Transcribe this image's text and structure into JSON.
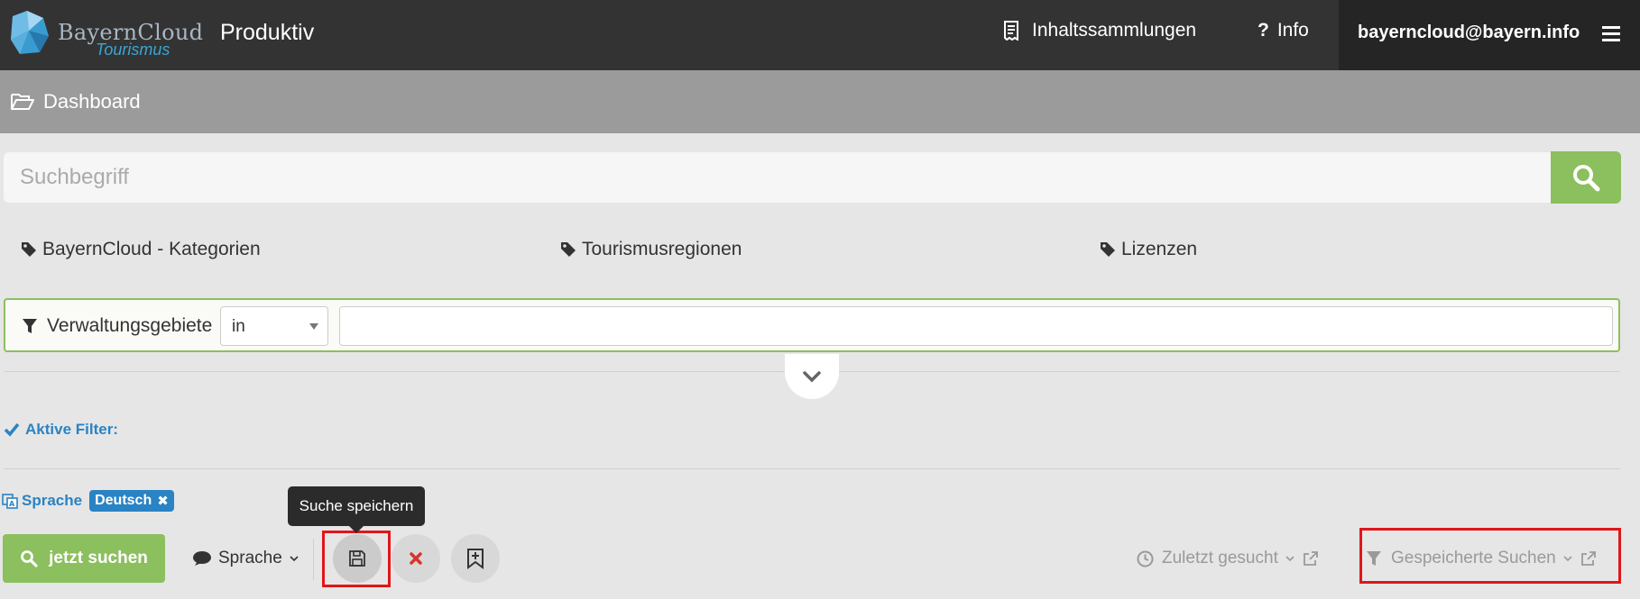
{
  "header": {
    "logo_name": "BayernCloud",
    "logo_subtitle": "Tourismus",
    "environment": "Produktiv",
    "nav": {
      "collections": "Inhaltssammlungen",
      "info": "Info"
    },
    "user_email": "bayerncloud@bayern.info"
  },
  "breadcrumb": {
    "current": "Dashboard"
  },
  "search": {
    "placeholder": "Suchbegriff",
    "value": ""
  },
  "facets": [
    {
      "label": "BayernCloud - Kategorien"
    },
    {
      "label": "Tourismusregionen"
    },
    {
      "label": "Lizenzen"
    }
  ],
  "filter": {
    "label": "Verwaltungsgebiete",
    "operator": "in",
    "value": ""
  },
  "active_filters": {
    "label": "Aktive Filter:",
    "language_label": "Sprache",
    "language_value": "Deutsch"
  },
  "toolbar": {
    "search_button": "jetzt suchen",
    "language_dropdown": "Sprache",
    "save_tooltip": "Suche speichern",
    "recent_searches": "Zuletzt gesucht",
    "saved_searches": "Gespeicherte Suchen"
  },
  "colors": {
    "topbar": "#333333",
    "accent_green": "#8cbf5e",
    "accent_blue": "#2a83c4",
    "highlight_red": "#e0161b"
  }
}
